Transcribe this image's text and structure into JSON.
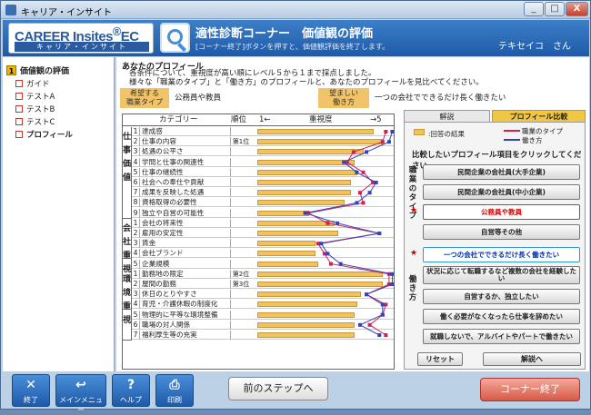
{
  "window": {
    "title": "キャリア・インサイト",
    "min": "_",
    "max": "□",
    "close": "X"
  },
  "header": {
    "logo_main": "CAREER Insites",
    "logo_ec": "EC",
    "logo_sub": "キャリア・インサイト",
    "title": "適性診断コーナー　価値観の評価",
    "subtitle": "[コーナー終了]ボタンを押すと、価値観評価を終了します。",
    "user": "テキセイコ　さん"
  },
  "sidebar": {
    "heading_num": "1",
    "heading": "価値観の評価",
    "items": [
      {
        "label": "ガイド"
      },
      {
        "label": "テストA"
      },
      {
        "label": "テストB"
      },
      {
        "label": "テストC"
      },
      {
        "label": "プロフィール"
      }
    ]
  },
  "main": {
    "section_title": "あなたのプロフィール",
    "instr1": "各条件について、重視度が高い順にレベル５から１まで採点しました。",
    "instr2": "様々な「職業のタイプ」と「働き方」のプロフィールと、あなたのプロフィールを見比べてください。",
    "job_label": "希望する\n職業タイプ",
    "job_value": "公務員や教員",
    "work_label": "望ましい\n働き方",
    "work_value": "一つの会社でできるだけ長く働きたい"
  },
  "table": {
    "h_category": "カテゴリー",
    "h_rank": "順位",
    "h_left": "1←",
    "h_mid": "重視度",
    "h_right": "→5",
    "groups": [
      {
        "label": "仕事の価値",
        "chars": [
          "仕",
          "事",
          "価",
          "値"
        ]
      },
      {
        "label": "会社の重視",
        "chars": [
          "会",
          "社",
          "重",
          "視"
        ]
      },
      {
        "label": "環境の重視",
        "chars": [
          "環",
          "境",
          "重",
          "視"
        ]
      }
    ],
    "rows": [
      {
        "n": "1",
        "label": "達成感",
        "rank": ""
      },
      {
        "n": "2",
        "label": "仕事の内容",
        "rank": "第1位"
      },
      {
        "n": "3",
        "label": "処遇の公平さ",
        "rank": ""
      },
      {
        "n": "4",
        "label": "学問と仕事の関連性",
        "rank": ""
      },
      {
        "n": "5",
        "label": "仕事の継続性",
        "rank": ""
      },
      {
        "n": "6",
        "label": "社会への奉仕や貢献",
        "rank": ""
      },
      {
        "n": "7",
        "label": "成果を反映した処遇",
        "rank": ""
      },
      {
        "n": "8",
        "label": "資格取得の必要性",
        "rank": ""
      },
      {
        "n": "9",
        "label": "独立や自営の可能性",
        "rank": ""
      },
      {
        "n": "1",
        "label": "会社の将来性",
        "rank": ""
      },
      {
        "n": "2",
        "label": "雇用の安定性",
        "rank": ""
      },
      {
        "n": "3",
        "label": "賃金",
        "rank": ""
      },
      {
        "n": "4",
        "label": "会社ブランド",
        "rank": ""
      },
      {
        "n": "5",
        "label": "企業規模",
        "rank": ""
      },
      {
        "n": "1",
        "label": "勤務地の限定",
        "rank": "第2位"
      },
      {
        "n": "2",
        "label": "屋間の勤務",
        "rank": "第3位"
      },
      {
        "n": "3",
        "label": "休日のとりやすさ",
        "rank": ""
      },
      {
        "n": "4",
        "label": "育児・介護休暇の制度化",
        "rank": ""
      },
      {
        "n": "5",
        "label": "物理的に平等な環境整備",
        "rank": ""
      },
      {
        "n": "6",
        "label": "職場の対人関係",
        "rank": ""
      },
      {
        "n": "7",
        "label": "福利厚生等の充実",
        "rank": ""
      }
    ],
    "bar_levels": [
      4.6,
      4.9,
      4.3,
      4.0,
      4.1,
      3.9,
      3.9,
      3.7,
      2.6,
      3.4,
      3.5,
      2.8,
      2.8,
      2.9,
      4.9,
      4.9,
      4.2,
      4.1,
      4.0,
      4.0,
      4.0
    ],
    "job_type_levels": [
      4.7,
      4.6,
      3.7,
      3.5,
      4.0,
      4.3,
      3.9,
      4.0,
      2.3,
      2.9,
      4.5,
      2.6,
      2.8,
      3.0,
      4.8,
      4.8,
      4.1,
      4.7,
      4.6,
      4.2,
      4.7
    ],
    "work_style_levels": [
      4.9,
      4.8,
      4.1,
      3.4,
      3.8,
      4.4,
      4.2,
      3.8,
      2.2,
      3.2,
      4.5,
      2.7,
      2.9,
      3.3,
      4.9,
      4.9,
      4.1,
      4.6,
      4.6,
      3.9,
      4.5
    ]
  },
  "right": {
    "tab_explain": "解説",
    "tab_compare": "プロフィール比較",
    "legend_result": ":回答の結果",
    "legend_job": "職業のタイプ",
    "legend_work": "働き方",
    "job_color": "#cc2255",
    "work_color": "#3344bb",
    "prompt": "比較したいプロフィール項目をクリックしてください",
    "job_section": "職業のタイプ",
    "work_section": "働き方",
    "job_buttons": [
      "民間企業の会社員(大手企業)",
      "民間企業の会社員(中小企業)",
      "公務員や教員",
      "自営等その他"
    ],
    "work_buttons": [
      "一つの会社でできるだけ長く働きたい",
      "状況に応じて転職するなど複数の会社を経験したい",
      "自営するか、独立したい",
      "働く必要がなくなったら仕事を辞めたい",
      "就職しないで、アルバイトやパートで働きたい"
    ],
    "reset": "リセット",
    "explain_btn": "解説へ"
  },
  "footer": {
    "end": "終了",
    "menu": "メインメニュー",
    "help": "ヘルプ",
    "print": "印刷",
    "prev": "前のステップへ",
    "corner_end": "コーナー終了"
  }
}
